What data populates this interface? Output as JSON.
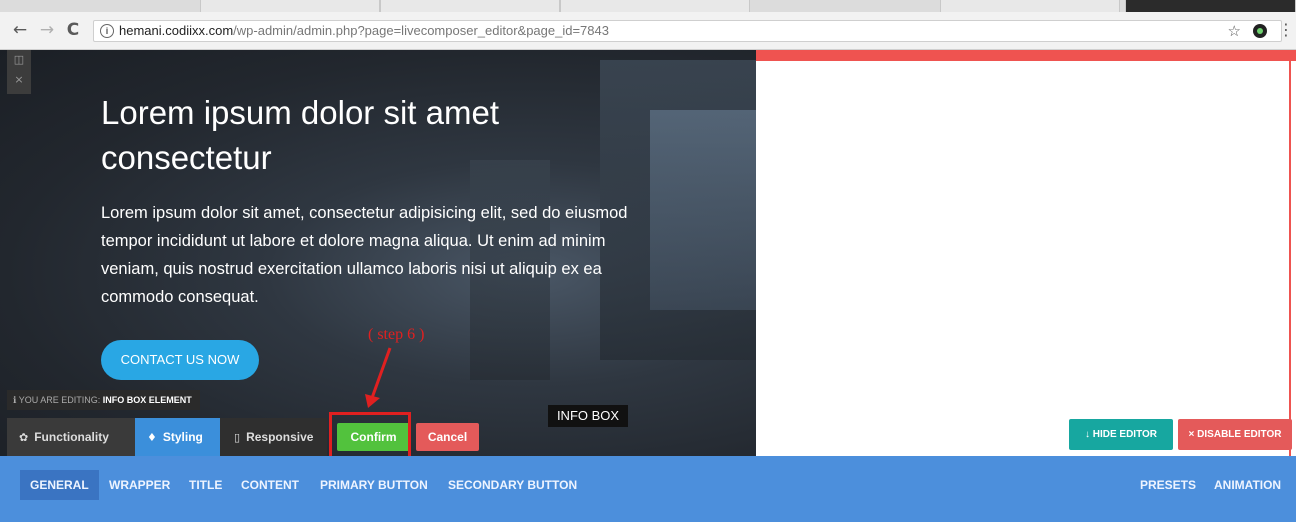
{
  "browser": {
    "url_host": "hemani.codiixx.com",
    "url_path": "/wp-admin/admin.php?page=livecomposer_editor&page_id=7843",
    "back_icon": "←",
    "forward_icon": "→",
    "reload_icon": "C",
    "star_icon": "☆",
    "menu_icon": "⋮"
  },
  "hero": {
    "title": "Lorem ipsum dolor sit amet consectetur",
    "body": "Lorem ipsum dolor sit amet, consectetur adipisicing elit, sed do eiusmod tempor incididunt ut labore et dolore magna aliqua. Ut enim ad minim veniam, quis nostrud exercitation ullamco laboris nisi ut aliquip ex ea commodo consequat.",
    "cta_label": "CONTACT US NOW"
  },
  "annotation": {
    "step_label": "( step 6 )",
    "color": "#e02020"
  },
  "editor": {
    "editing_prefix": "YOU ARE EDITING:",
    "editing_element": "INFO BOX ELEMENT",
    "infobox_tag": "INFO BOX",
    "tabs": {
      "functionality": "Functionality",
      "styling": "Styling",
      "responsive": "Responsive"
    },
    "confirm_label": "Confirm",
    "cancel_label": "Cancel",
    "hide_editor_label": "HIDE EDITOR",
    "disable_editor_label": "DISABLE EDITOR"
  },
  "bottom_nav": {
    "items": [
      "GENERAL",
      "WRAPPER",
      "TITLE",
      "CONTENT",
      "PRIMARY BUTTON",
      "SECONDARY BUTTON"
    ],
    "right_items": [
      "PRESETS",
      "ANIMATION"
    ]
  },
  "colors": {
    "accent_blue": "#4c8fdc",
    "confirm_green": "#52c23d",
    "cancel_red": "#e45a5a",
    "teal": "#17a7a0",
    "cta_blue": "#29a7e4"
  }
}
